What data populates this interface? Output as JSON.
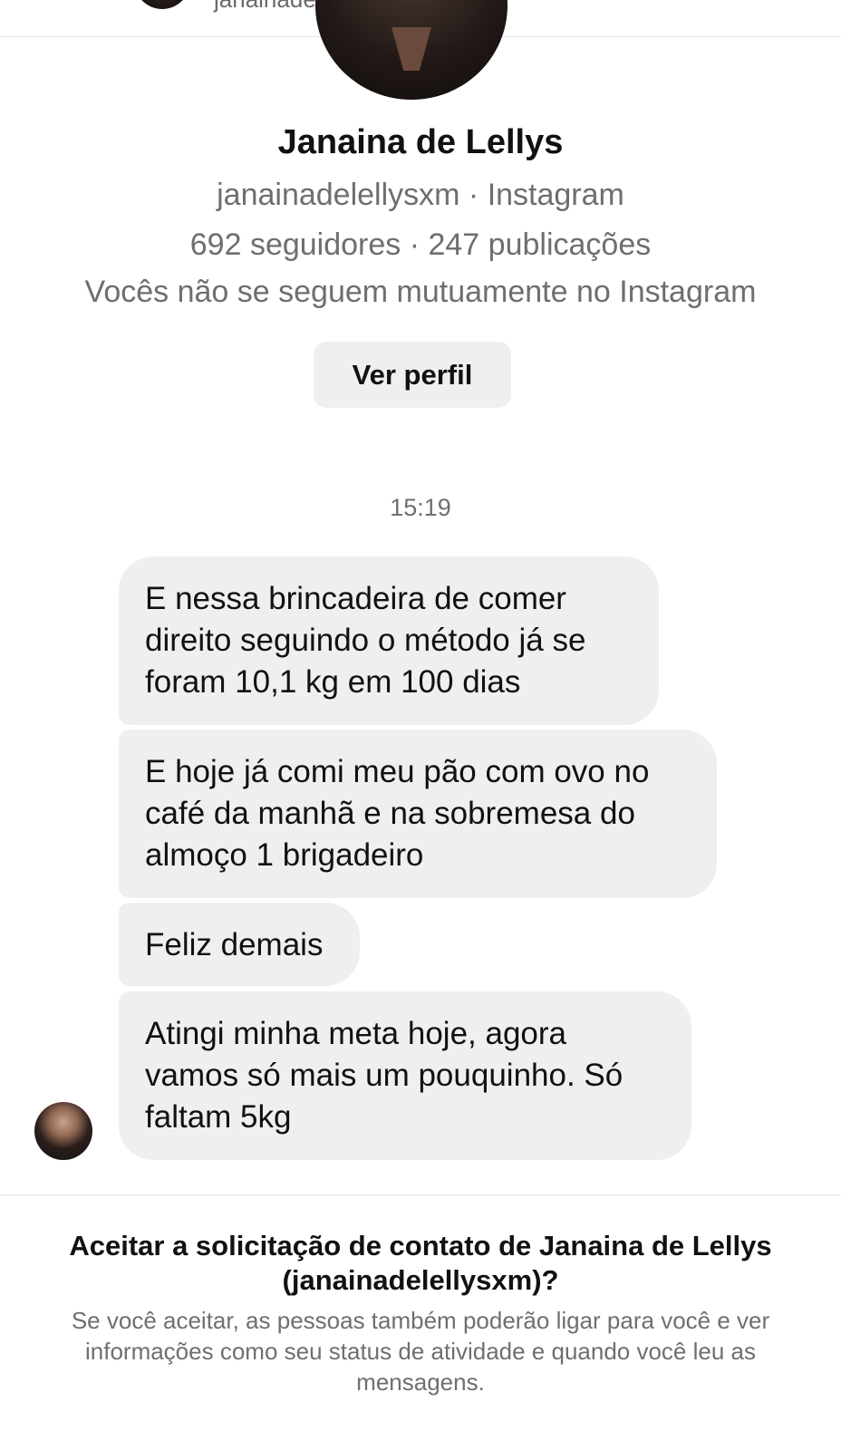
{
  "header": {
    "username": "janainadelellysxm"
  },
  "profile": {
    "name": "Janaina de Lellys",
    "handle_line": "janainadelellysxm · Instagram",
    "stats_line": "692 seguidores · 247 publicações",
    "mutual_line": "Vocês não se seguem mutuamente no Instagram",
    "view_profile_label": "Ver perfil"
  },
  "conversation": {
    "timestamp": "15:19",
    "messages": [
      {
        "text": "E nessa brincadeira de comer\ndireito seguindo o método já se\nforam 10,1 kg em 100 dias"
      },
      {
        "text": "E hoje já comi meu pão com ovo no\ncafé da manhã e na sobremesa do\nalmoço 1 brigadeiro"
      },
      {
        "text": "Feliz demais"
      },
      {
        "text": "Atingi minha meta hoje, agora\nvamos só mais um pouquinho. Só\nfaltam 5kg"
      }
    ]
  },
  "request": {
    "title": "Aceitar a solicitação de contato de Janaina de Lellys (janainadelellysxm)?",
    "body": "Se você aceitar, as pessoas também poderão ligar para você e ver informações como seu status de atividade e quando você leu as mensagens."
  }
}
